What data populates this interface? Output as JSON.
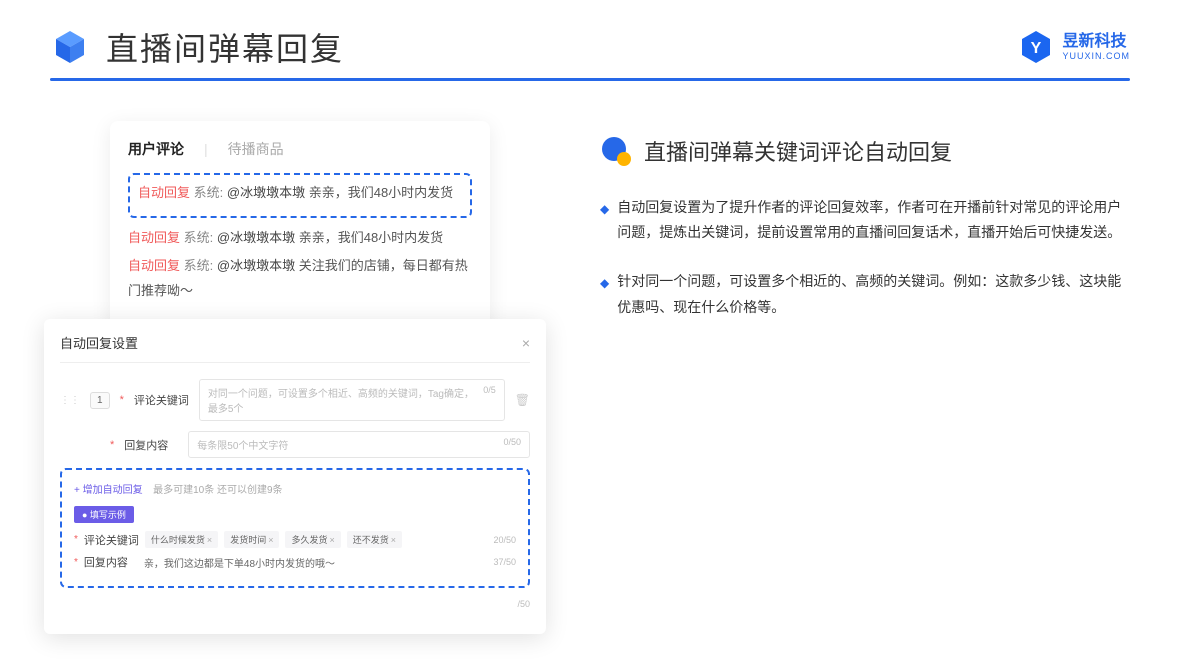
{
  "header": {
    "title": "直播间弹幕回复",
    "brand": "昱新科技",
    "brand_sub": "YUUXIN.COM"
  },
  "card1": {
    "tab1": "用户评论",
    "tab2": "待播商品",
    "c1_auto": "自动回复",
    "c1_sys": "系统:",
    "c1_user": "@冰墩墩本墩",
    "c1_text": "亲亲，我们48小时内发货",
    "c2_auto": "自动回复",
    "c2_sys": "系统:",
    "c2_user": "@冰墩墩本墩",
    "c2_text": "亲亲，我们48小时内发货",
    "c3_auto": "自动回复",
    "c3_sys": "系统:",
    "c3_user": "@冰墩墩本墩",
    "c3_text": "关注我们的店铺，每日都有热门推荐呦～"
  },
  "card2": {
    "title": "自动回复设置",
    "close": "×",
    "num": "1",
    "lbl1": "评论关键词",
    "ph1": "对同一个问题，可设置多个相近、高频的关键词，Tag确定，最多5个",
    "cnt1": "0/5",
    "lbl2": "回复内容",
    "ph2": "每条限50个中文字符",
    "cnt2": "0/50",
    "add": "+ 增加自动回复",
    "add_hint": "最多可建10条 还可以创建9条",
    "example": "● 填写示例",
    "ex_lbl1": "评论关键词",
    "chip1": "什么时候发货",
    "chip2": "发货时间",
    "chip3": "多久发货",
    "chip4": "还不发货",
    "ex_cnt1": "20/50",
    "ex_lbl2": "回复内容",
    "ex_val": "亲，我们这边都是下单48小时内发货的哦～",
    "ex_cnt2": "37/50",
    "tail_cnt": "/50"
  },
  "right": {
    "section_title": "直播间弹幕关键词评论自动回复",
    "b1": "自动回复设置为了提升作者的评论回复效率，作者可在开播前针对常见的评论用户问题，提炼出关键词，提前设置常用的直播间回复话术，直播开始后可快捷发送。",
    "b2": "针对同一个问题，可设置多个相近的、高频的关键词。例如：这款多少钱、这块能优惠吗、现在什么价格等。"
  }
}
